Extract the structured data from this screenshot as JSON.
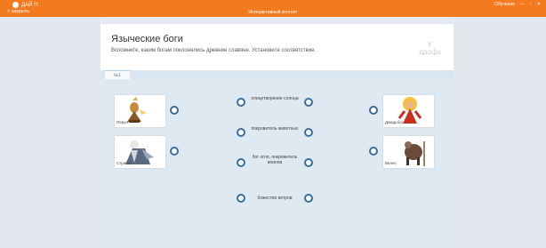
{
  "app": {
    "title": "ДАЙ !!!",
    "close_label": "× закрыть",
    "center_title": "Интерактивный контент",
    "window_label": "Обучение"
  },
  "exercise": {
    "title": "Языческие боги",
    "subtitle": "Вспомните, каким богам поклонялись древние славяне. Установите соответствие.",
    "brand": "дрофа",
    "tab_label": "№1"
  },
  "gods": [
    {
      "name": "Перун",
      "icon": "perun-figure"
    },
    {
      "name": "Стрибог",
      "icon": "stribog-figure"
    },
    {
      "name": "Даждьбог",
      "icon": "dazhdbog-figure"
    },
    {
      "name": "Велес",
      "icon": "veles-figure"
    }
  ],
  "terms": [
    {
      "text": "олицетворение солнца"
    },
    {
      "text": "покровитель животных"
    },
    {
      "text": "бог огня, покровитель воинов"
    },
    {
      "text": "божество ветров"
    }
  ],
  "colors": {
    "accent": "#f47a1f",
    "connector": "#3b6fa0"
  }
}
